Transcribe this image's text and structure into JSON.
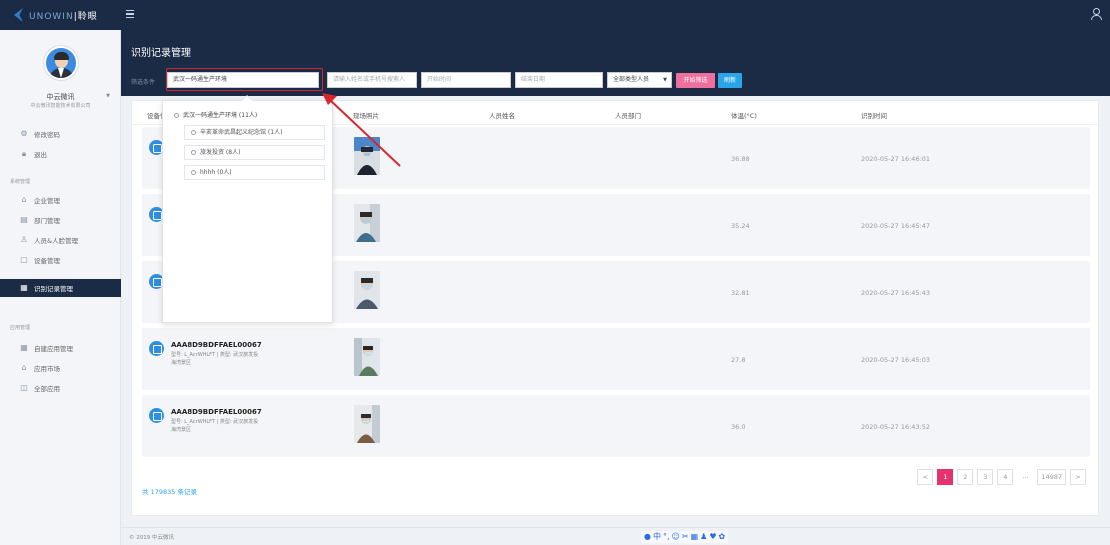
{
  "app": {
    "brand_prefix": "UNOWIN",
    "brand_suffix": "|聆眼",
    "colors": {
      "nav_bg": "#1b2a45",
      "accent_blue": "#2aa5e8",
      "accent_pink": "#ef6f9e",
      "page_active": "#e6336f",
      "annotation_red": "#d7272b"
    }
  },
  "user": {
    "name": "中云微讯",
    "company": "中云微讯智能技术有限公司"
  },
  "sidebar": {
    "account_items": [
      {
        "label": "修改密码",
        "icon": "gear-icon"
      },
      {
        "label": "退出",
        "icon": "lock-icon"
      }
    ],
    "system_section": "系统管理",
    "system_items": [
      {
        "label": "企业管理",
        "icon": "home-icon"
      },
      {
        "label": "部门管理",
        "icon": "folder-icon"
      },
      {
        "label": "人员&人脸管理",
        "icon": "user-icon"
      },
      {
        "label": "设备管理",
        "icon": "device-icon"
      },
      {
        "label": "识别记录管理",
        "icon": "grid-icon",
        "active": true
      }
    ],
    "app_section": "应用管理",
    "app_items": [
      {
        "label": "自建应用管理",
        "icon": "grid-icon"
      },
      {
        "label": "应用市场",
        "icon": "store-icon"
      },
      {
        "label": "全部应用",
        "icon": "apps-icon"
      }
    ]
  },
  "page": {
    "title": "识别记录管理",
    "filter_label": "筛选条件",
    "org_value": "武汉一码通生产环境",
    "keyword_placeholder": "请输入姓名或手机号搜索人",
    "start_placeholder": "开始时间",
    "end_placeholder": "结束日期",
    "type_select": "全部类型人员",
    "filter_button": "开始筛选",
    "refresh_button": "刷新"
  },
  "dropdown": {
    "root": "武汉一码通生产环境 (11人)",
    "children": [
      "辛亥革命武昌起义纪念馆 (1人)",
      "旅发投资 (8人)",
      "hhhh (0人)"
    ]
  },
  "table": {
    "headers": {
      "device": "设备信",
      "photo": "现场照片",
      "name": "人员姓名",
      "dept": "人员部门",
      "temp": "体温(°C)",
      "time": "识别时间"
    },
    "rows": [
      {
        "device_id": "",
        "meta": "",
        "area": "",
        "temp": "36.88",
        "time": "2020-05-27 16:46:01"
      },
      {
        "device_id": "",
        "meta": "",
        "area": "",
        "temp": "35.24",
        "time": "2020-05-27 16:45:47"
      },
      {
        "device_id": "",
        "meta": "",
        "area": "",
        "temp": "32.81",
        "time": "2020-05-27 16:45:43"
      },
      {
        "device_id": "AAA8D9BDFFAEL00067",
        "meta": "型号: L_AcrWHLFT | 类型: 武汉旅发投",
        "area": "海湾景区",
        "temp": "27.8",
        "time": "2020-05-27 16:45:03"
      },
      {
        "device_id": "AAA8D9BDFFAEL00067",
        "meta": "型号: L_AcrWHLFT | 类型: 武汉旅发投",
        "area": "海湾景区",
        "temp": "36.0",
        "time": "2020-05-27 16:43:52"
      }
    ],
    "total": "共 179835 条记录"
  },
  "pagination": {
    "prev": "<",
    "pages": [
      "1",
      "2",
      "3",
      "4"
    ],
    "ellipsis": "...",
    "last": "14987",
    "next": ">",
    "current": "1"
  },
  "footer": {
    "copyright": "© 2019 中云微讯",
    "ime_icons": [
      "ime-logo-icon",
      "zh-mode-icon",
      "punctuation-icon",
      "emoji-icon",
      "tools-icon",
      "keyboard-icon",
      "user-icon",
      "skin-icon",
      "settings-icon"
    ]
  }
}
